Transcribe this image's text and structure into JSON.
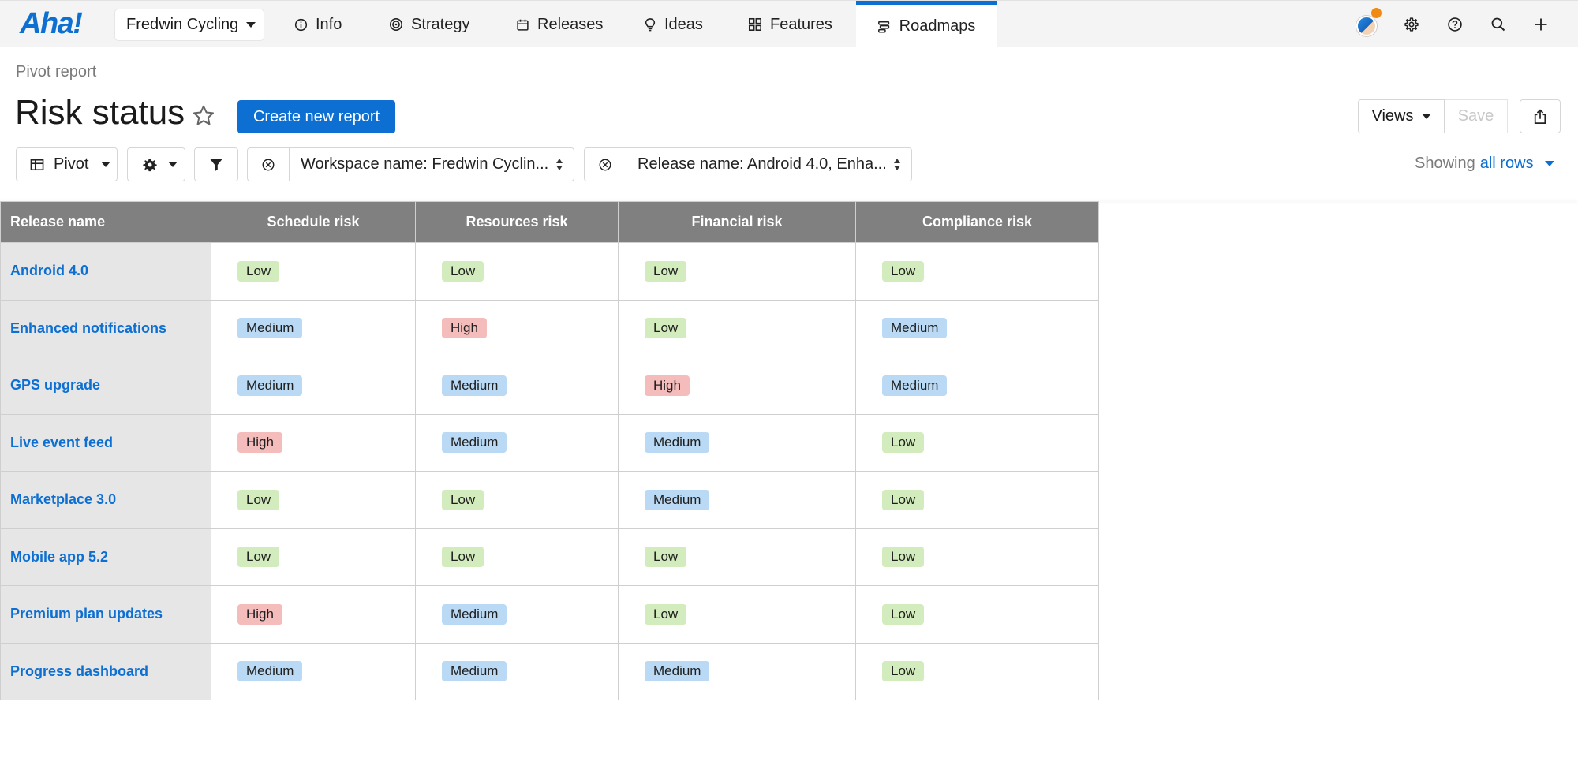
{
  "app": {
    "logo": "Aha!"
  },
  "nav": {
    "workspace": "Fredwin Cycling",
    "items": [
      {
        "label": "Info",
        "icon": "info-icon"
      },
      {
        "label": "Strategy",
        "icon": "target-icon"
      },
      {
        "label": "Releases",
        "icon": "calendar-icon"
      },
      {
        "label": "Ideas",
        "icon": "lightbulb-icon"
      },
      {
        "label": "Features",
        "icon": "grid-icon"
      },
      {
        "label": "Roadmaps",
        "icon": "roadmap-icon",
        "active": true
      }
    ]
  },
  "header": {
    "breadcrumb": "Pivot report",
    "title": "Risk status",
    "create_label": "Create new report",
    "views_label": "Views",
    "save_label": "Save"
  },
  "toolbar": {
    "pivot_label": "Pivot",
    "filter1": "Workspace name: Fredwin Cyclin...",
    "filter2": "Release name: Android 4.0, Enha...",
    "showing_prefix": "Showing",
    "showing_link": "all rows"
  },
  "colors": {
    "accent": "#0c6fd1",
    "low": "#d3ecbd",
    "medium": "#b9d9f4",
    "high": "#f5bcbc",
    "header": "#808080"
  },
  "table": {
    "columns": [
      "Release name",
      "Schedule risk",
      "Resources risk",
      "Financial risk",
      "Compliance risk"
    ],
    "rows": [
      [
        "Android 4.0",
        "Low",
        "Low",
        "Low",
        "Low"
      ],
      [
        "Enhanced notifications",
        "Medium",
        "High",
        "Low",
        "Medium"
      ],
      [
        "GPS upgrade",
        "Medium",
        "Medium",
        "High",
        "Medium"
      ],
      [
        "Live event feed",
        "High",
        "Medium",
        "Medium",
        "Low"
      ],
      [
        "Marketplace 3.0",
        "Low",
        "Low",
        "Medium",
        "Low"
      ],
      [
        "Mobile app 5.2",
        "Low",
        "Low",
        "Low",
        "Low"
      ],
      [
        "Premium plan updates",
        "High",
        "Medium",
        "Low",
        "Low"
      ],
      [
        "Progress dashboard",
        "Medium",
        "Medium",
        "Medium",
        "Low"
      ]
    ]
  }
}
